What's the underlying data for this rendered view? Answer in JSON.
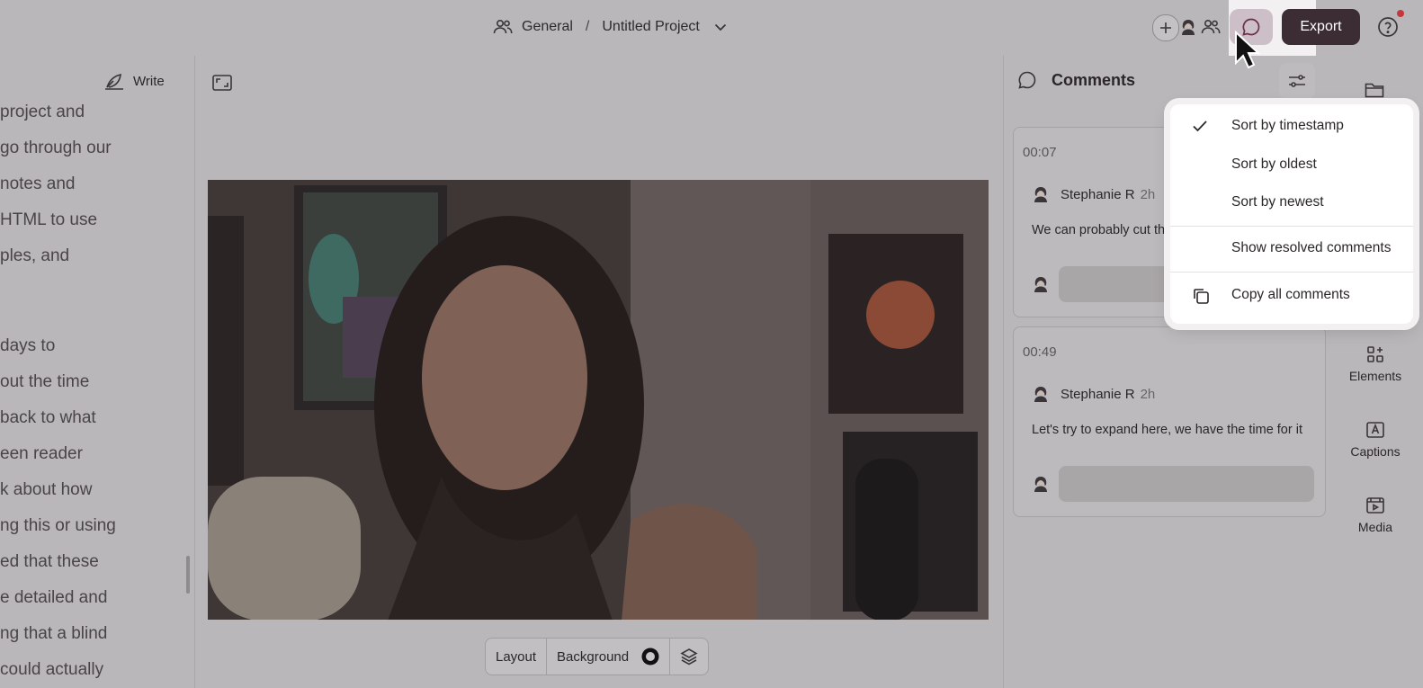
{
  "header": {
    "workspace": "General",
    "separator": "/",
    "project": "Untitled Project",
    "export_label": "Export"
  },
  "script": {
    "write_label": "Write",
    "lines": [
      "project and",
      "go through our",
      "notes and",
      "HTML to use",
      "ples, and",
      "days to",
      "out the time",
      "back to what",
      "een reader",
      "k about how",
      "ng this or using",
      "ed that these",
      "e detailed and",
      "ng that a blind",
      "could actually"
    ]
  },
  "stage": {
    "layout_label": "Layout",
    "background_label": "Background"
  },
  "comments": {
    "title": "Comments",
    "items": [
      {
        "timestamp": "00:07",
        "author": "Stephanie R",
        "ago": "2h",
        "text": "We can probably cut th... repetitive"
      },
      {
        "timestamp": "00:49",
        "author": "Stephanie R",
        "ago": "2h",
        "text": "Let's try to expand here, we have the time for it"
      }
    ]
  },
  "rail": {
    "items": [
      {
        "label": "Elements",
        "icon": "elements-icon"
      },
      {
        "label": "Captions",
        "icon": "captions-icon"
      },
      {
        "label": "Media",
        "icon": "media-icon"
      }
    ]
  },
  "menu": {
    "items": [
      {
        "label": "Sort by timestamp",
        "checked": true
      },
      {
        "label": "Sort by oldest",
        "checked": false
      },
      {
        "label": "Sort by newest",
        "checked": false
      },
      {
        "label": "Show resolved comments",
        "checked": false
      },
      {
        "label": "Copy all comments",
        "icon": "copy-icon"
      }
    ]
  },
  "colors": {
    "overlay": "#b9b7b9",
    "export_bg": "#3b2d33",
    "notification": "#c4373f",
    "menu_bg": "#ffffff"
  }
}
